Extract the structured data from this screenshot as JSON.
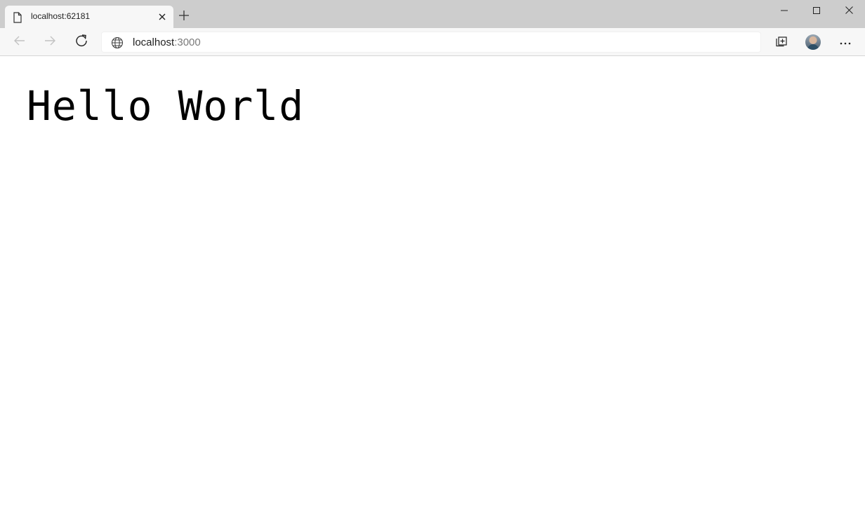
{
  "browser": {
    "tab": {
      "title": "localhost:62181"
    },
    "address_bar": {
      "host": "localhost",
      "port": ":3000"
    },
    "icons": {
      "tab_page": "page-icon",
      "tab_close": "close-icon",
      "new_tab": "plus-icon",
      "minimize": "minimize-icon",
      "maximize": "maximize-icon",
      "close_window": "close-icon",
      "back": "arrow-left-icon",
      "forward": "arrow-right-icon",
      "refresh": "refresh-icon",
      "site_info": "globe-icon",
      "collections": "collections-icon",
      "profile": "avatar",
      "menu": "more-icon"
    }
  },
  "page": {
    "heading": "Hello World"
  },
  "colors": {
    "titlebar": "#cdcdcd",
    "toolbar": "#f7f7f7",
    "page_background": "#ffffff",
    "text": "#000000"
  }
}
